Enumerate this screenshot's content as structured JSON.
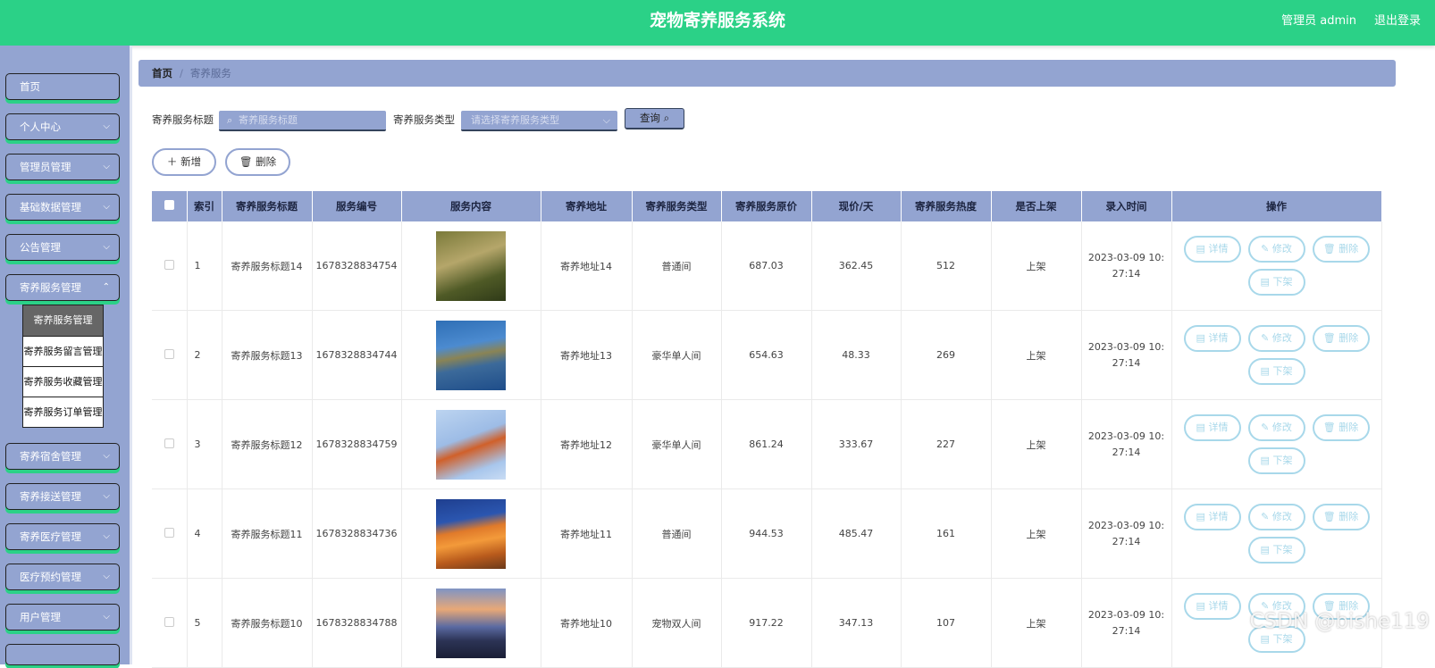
{
  "header": {
    "title": "宠物寄养服务系统",
    "user": "管理员 admin",
    "logout": "退出登录"
  },
  "sidebar": {
    "items": [
      {
        "label": "首页"
      },
      {
        "label": "个人中心"
      },
      {
        "label": "管理员管理"
      },
      {
        "label": "基础数据管理"
      },
      {
        "label": "公告管理"
      },
      {
        "label": "寄养服务管理"
      },
      {
        "label": "寄养宿舍管理"
      },
      {
        "label": "寄养接送管理"
      },
      {
        "label": "寄养医疗管理"
      },
      {
        "label": "医疗预约管理"
      },
      {
        "label": "用户管理"
      }
    ],
    "submenu": [
      {
        "label": "寄养服务管理"
      },
      {
        "label": "寄养服务留言管理"
      },
      {
        "label": "寄养服务收藏管理"
      },
      {
        "label": "寄养服务订单管理"
      }
    ]
  },
  "breadcrumb": {
    "home": "首页",
    "sep": "/",
    "current": "寄养服务"
  },
  "search": {
    "title_label": "寄养服务标题",
    "title_placeholder": "寄养服务标题",
    "type_label": "寄养服务类型",
    "type_placeholder": "请选择寄养服务类型",
    "query_label": "查询"
  },
  "actions": {
    "add_label": "新增",
    "delete_label": "删除"
  },
  "table": {
    "headers": [
      "索引",
      "寄养服务标题",
      "服务编号",
      "服务内容",
      "寄养地址",
      "寄养服务类型",
      "寄养服务原价",
      "现价/天",
      "寄养服务热度",
      "是否上架",
      "录入时间",
      "操作"
    ],
    "op_labels": {
      "detail": "详情",
      "edit": "修改",
      "delete": "删除",
      "down": "下架"
    },
    "rows": [
      {
        "idx": "1",
        "title": "寄养服务标题14",
        "code": "1678328834754",
        "address": "寄养地址14",
        "type": "普通间",
        "orig_price": "687.03",
        "price": "362.45",
        "heat": "512",
        "listed": "上架",
        "time_a": "2023-03-09 10:",
        "time_b": "27:14",
        "thumb": "forest-path"
      },
      {
        "idx": "2",
        "title": "寄养服务标题13",
        "code": "1678328834744",
        "address": "寄养地址13",
        "type": "豪华单人间",
        "orig_price": "654.63",
        "price": "48.33",
        "heat": "269",
        "listed": "上架",
        "time_a": "2023-03-09 10:",
        "time_b": "27:14",
        "thumb": "river-delta"
      },
      {
        "idx": "3",
        "title": "寄养服务标题12",
        "code": "1678328834759",
        "address": "寄养地址12",
        "type": "豪华单人间",
        "orig_price": "861.24",
        "price": "333.67",
        "heat": "227",
        "listed": "上架",
        "time_a": "2023-03-09 10:",
        "time_b": "27:14",
        "thumb": "autumn-leaves"
      },
      {
        "idx": "4",
        "title": "寄养服务标题11",
        "code": "1678328834736",
        "address": "寄养地址11",
        "type": "普通间",
        "orig_price": "944.53",
        "price": "485.47",
        "heat": "161",
        "listed": "上架",
        "time_a": "2023-03-09 10:",
        "time_b": "27:14",
        "thumb": "desert-rock"
      },
      {
        "idx": "5",
        "title": "寄养服务标题10",
        "code": "1678328834788",
        "address": "寄养地址10",
        "type": "宠物双人间",
        "orig_price": "917.22",
        "price": "347.13",
        "heat": "107",
        "listed": "上架",
        "time_a": "2023-03-09 10:",
        "time_b": "27:14",
        "thumb": "mountain-city"
      }
    ]
  },
  "watermark": "CSDN @bishe119",
  "colors": {
    "header": "#2bd187",
    "accent": "#93a4d1",
    "op_button": "#a8d8ea"
  }
}
